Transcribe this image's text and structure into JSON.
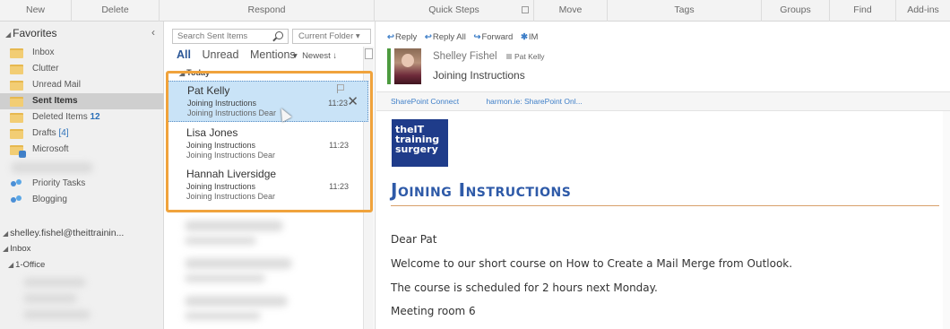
{
  "ribbon": {
    "groups": [
      "New",
      "Delete",
      "Respond",
      "Quick Steps",
      "Move",
      "Tags",
      "Groups",
      "Find",
      "Add-ins"
    ]
  },
  "folders": {
    "favorites_label": "Favorites",
    "items": [
      {
        "label": "Inbox",
        "count": ""
      },
      {
        "label": "Clutter",
        "count": ""
      },
      {
        "label": "Unread Mail",
        "count": ""
      },
      {
        "label": "Sent Items",
        "count": ""
      },
      {
        "label": "Deleted Items",
        "count": "12"
      },
      {
        "label": "Drafts",
        "count": "[4]"
      },
      {
        "label": "Microsoft",
        "count": ""
      }
    ],
    "groups": [
      {
        "label": "Priority Tasks"
      },
      {
        "label": "Blogging"
      }
    ],
    "account": "shelley.fishel@theittrainin...",
    "inbox_label": "Inbox",
    "subfolder_label": "1-Office"
  },
  "list": {
    "search_placeholder": "Search Sent Items",
    "scope": "Current Folder",
    "filters": [
      "All",
      "Unread",
      "Mentions"
    ],
    "sort": "Newest",
    "group_header": "Today",
    "messages": [
      {
        "from": "Pat Kelly",
        "subject": "Joining Instructions",
        "preview": "Joining Instructions  Dear",
        "time": "11:23"
      },
      {
        "from": "Lisa Jones",
        "subject": "Joining Instructions",
        "preview": "Joining Instructions  Dear",
        "time": "11:23"
      },
      {
        "from": "Hannah Liversidge",
        "subject": "Joining Instructions",
        "preview": "Joining Instructions  Dear",
        "time": "11:23"
      }
    ]
  },
  "reading": {
    "actions": [
      "Reply",
      "Reply All",
      "Forward",
      "IM"
    ],
    "sender": "Shelley Fishel",
    "recipient": "Pat Kelly",
    "subject": "Joining Instructions",
    "infobar": [
      "SharePoint Connect",
      "harmon.ie: SharePoint Onl..."
    ],
    "logo": {
      "line1": "theIT",
      "line2": "training",
      "line3": "surgery"
    },
    "title": "Joining Instructions",
    "body": [
      "Dear Pat",
      "Welcome to our short course on How to Create a Mail Merge from Outlook.",
      "The course is scheduled for 2 hours next Monday.",
      "Meeting room 6"
    ]
  },
  "colors": {
    "accent": "#2b5797",
    "selection": "#c9e3f7",
    "highlight_border": "#f0a33c",
    "title_blue": "#2e5aa8"
  }
}
